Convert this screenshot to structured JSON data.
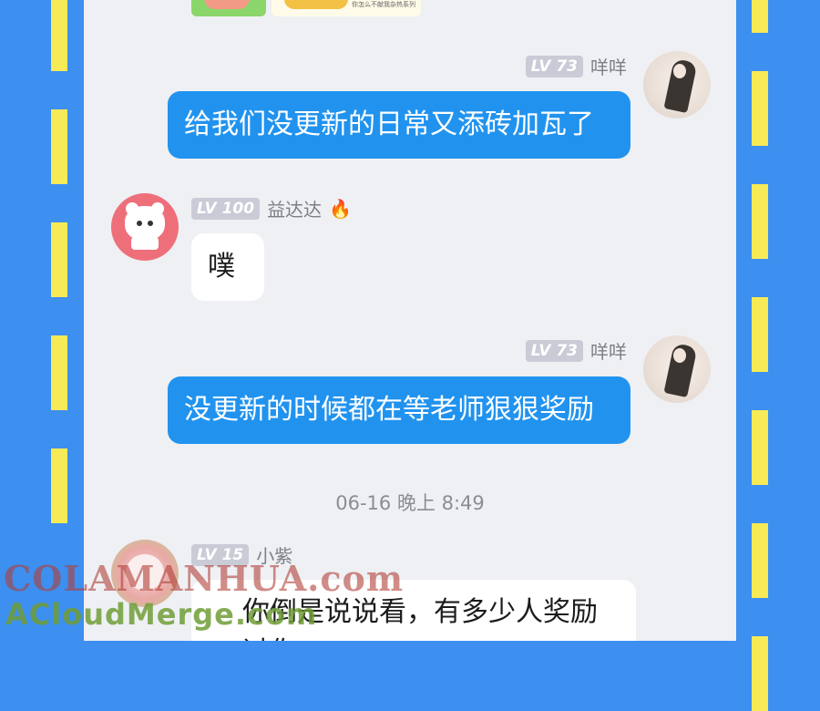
{
  "colors": {
    "background": "#3d8ff0",
    "stripe": "#f7ea57",
    "chat_bg": "#eef0f4",
    "outgoing_bubble": "#2193ef",
    "incoming_bubble": "#ffffff"
  },
  "header_sticker_caption": "你怎么不献我杂热系列",
  "messages": [
    {
      "level": "LV 73",
      "username": "咩咩",
      "text": "给我们没更新的日常又添砖加瓦了",
      "side": "right",
      "avatar": "girl-avatar"
    },
    {
      "level": "LV 100",
      "username": "益达达",
      "badge": "🔥",
      "text": "噗",
      "side": "left",
      "avatar": "bear-avatar"
    },
    {
      "level": "LV 73",
      "username": "咩咩",
      "text": "没更新的时候都在等老师狠狠奖励",
      "side": "right",
      "avatar": "girl-avatar"
    },
    {
      "level": "LV 15",
      "username": "小紫",
      "text": "你倒是说说看，有多少人奖励过你",
      "side": "left",
      "avatar": "cat-avatar"
    }
  ],
  "timestamp": "06-16 晚上 8:49",
  "watermark": {
    "line1": "COLAMANHUA.com",
    "line2": "ACloudMerge.com"
  }
}
